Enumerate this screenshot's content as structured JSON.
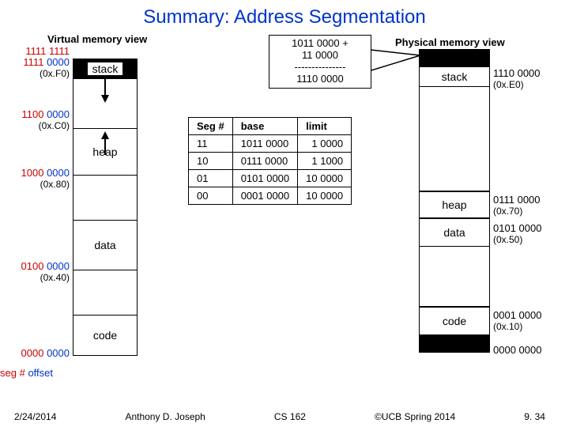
{
  "title": "Summary: Address Segmentation",
  "vmem": {
    "label": "Virtual memory view",
    "blocks": {
      "stack": "stack",
      "heap": "heap",
      "data": "data",
      "code": "code"
    },
    "addrs": {
      "a1_bin": "1111 1111",
      "a2_bin": "1111 0000",
      "a2_hex": "(0x.F0)",
      "a3_bin": "1100 0000",
      "a3_hex": "(0x.C0)",
      "a4_bin": "1000 0000",
      "a4_hex": "(0x.80)",
      "a5_bin": "0100 0000",
      "a5_hex": "(0x.40)",
      "a6_bin": "0000 0000"
    },
    "segoff": {
      "seg": "seg #",
      "off": "offset"
    }
  },
  "pmem": {
    "label": "Physical memory view",
    "blocks": {
      "stack": "stack",
      "heap": "heap",
      "data": "data",
      "code": "code"
    },
    "addrs": {
      "p1_bin": "1110 0000",
      "p1_hex": "(0x.E0)",
      "p2_bin": "0111 0000",
      "p2_hex": "(0x.70)",
      "p3_bin": "0101 0000",
      "p3_hex": "(0x.50)",
      "p4_bin": "0001 0000",
      "p4_hex": "(0x.10)",
      "p5_bin": "0000 0000"
    }
  },
  "callout": {
    "l1": "1011 0000 +",
    "l2": "11 0000",
    "l3": "---------------",
    "l4": "1110 0000"
  },
  "table": {
    "h_seg": "Seg #",
    "h_base": "base",
    "h_limit": "limit",
    "rows": [
      {
        "seg": "11",
        "base": "1011 0000",
        "limit": "1 0000"
      },
      {
        "seg": "10",
        "base": "0111 0000",
        "limit": "1 1000"
      },
      {
        "seg": "01",
        "base": "0101 0000",
        "limit": "10 0000"
      },
      {
        "seg": "00",
        "base": "0001 0000",
        "limit": "10 0000"
      }
    ]
  },
  "footer": {
    "date": "2/24/2014",
    "author": "Anthony D. Joseph",
    "course": "CS 162",
    "copyright": "©UCB Spring 2014",
    "slide": "9. 34"
  }
}
